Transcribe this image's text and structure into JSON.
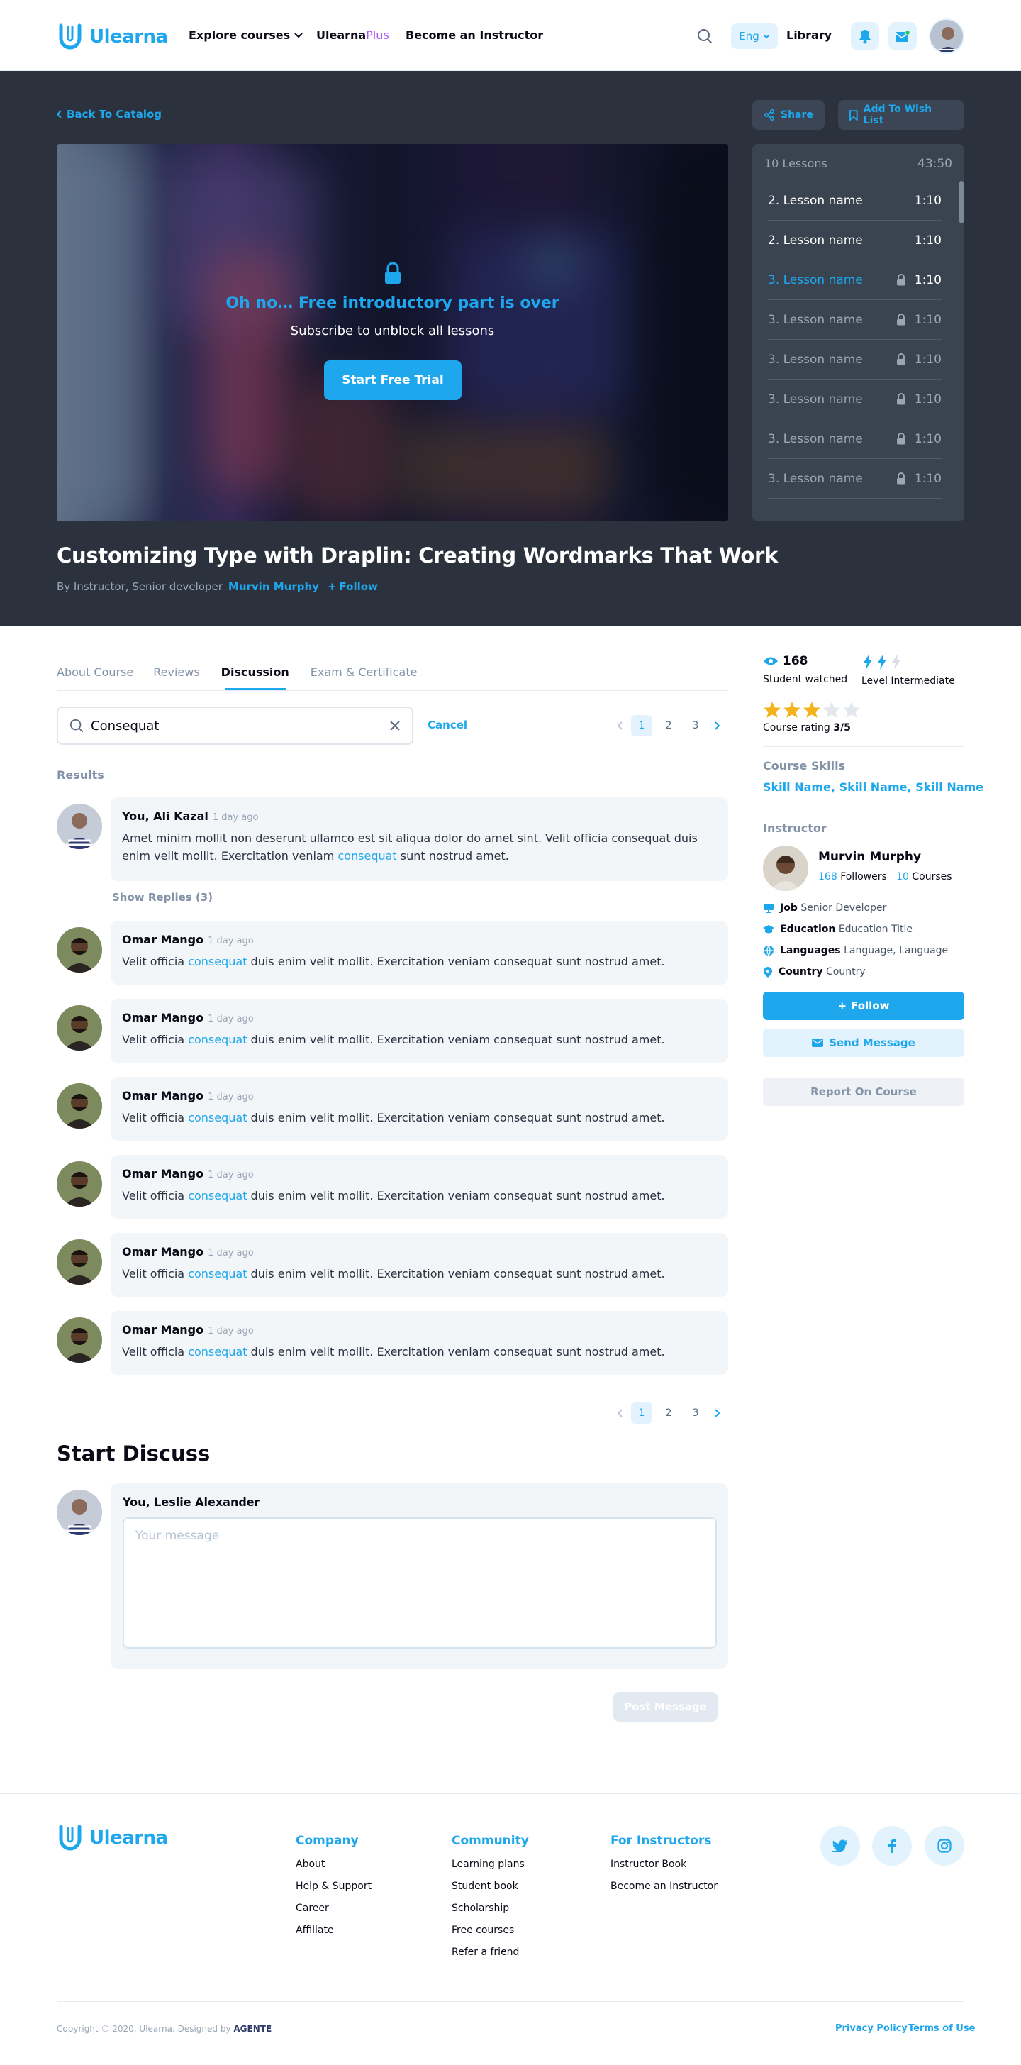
{
  "header": {
    "logo": "Ulearna",
    "nav": {
      "explore": "Explore courses",
      "plus_a": "Ulearna",
      "plus_b": "Plus",
      "instructor": "Become an Instructor"
    },
    "lang": "Eng",
    "library": "Library"
  },
  "hero": {
    "back": "Back To Catalog",
    "share": "Share",
    "wishlist": "Add To Wish List",
    "overlay_title": "Oh no… Free introductory part is over",
    "overlay_sub": "Subscribe to unblock all lessons",
    "trial_button": "Start Free Trial",
    "lessons_count": "10 Lessons",
    "lessons_total": "43:50",
    "lessons": [
      {
        "name": "2. Lesson name",
        "time": "1:10",
        "state": "open"
      },
      {
        "name": "2. Lesson name",
        "time": "1:10",
        "state": "open"
      },
      {
        "name": "3. Lesson name",
        "time": "1:10",
        "state": "active"
      },
      {
        "name": "3. Lesson name",
        "time": "1:10",
        "state": "locked"
      },
      {
        "name": "3. Lesson name",
        "time": "1:10",
        "state": "locked"
      },
      {
        "name": "3. Lesson name",
        "time": "1:10",
        "state": "locked"
      },
      {
        "name": "3. Lesson name",
        "time": "1:10",
        "state": "locked"
      },
      {
        "name": "3. Lesson name",
        "time": "1:10",
        "state": "locked"
      }
    ],
    "course_title": "Customizing Type with Draplin: Creating Wordmarks That Work",
    "by_line": "By Instructor, Senior developer",
    "author": "Murvin Murphy",
    "follow": "Follow"
  },
  "tabs": [
    "About Course",
    "Reviews",
    "Discussion",
    "Exam & Certificate"
  ],
  "search": {
    "value": "Consequat",
    "cancel": "Cancel"
  },
  "pagination": [
    "1",
    "2",
    "3"
  ],
  "results_label": "Results",
  "first_comment": {
    "author": "You, Ali Kazal",
    "time": "1 day ago",
    "text_a": "Amet minim mollit non deserunt ullamco est sit aliqua dolor do amet sint. Velit officia consequat duis enim velit mollit. Exercitation veniam ",
    "highlight": "consequat",
    "text_b": " sunt nostrud amet."
  },
  "show_replies": "Show Replies (3)",
  "replies": [
    {
      "author": "Omar Mango",
      "time": "1 day ago",
      "text_a": "Velit officia ",
      "highlight": "consequat",
      "text_b": " duis enim velit mollit. Exercitation veniam consequat sunt nostrud amet."
    },
    {
      "author": "Omar Mango",
      "time": "1 day ago",
      "text_a": "Velit officia ",
      "highlight": "consequat",
      "text_b": " duis enim velit mollit. Exercitation veniam consequat sunt nostrud amet."
    },
    {
      "author": "Omar Mango",
      "time": "1 day ago",
      "text_a": "Velit officia ",
      "highlight": "consequat",
      "text_b": " duis enim velit mollit. Exercitation veniam consequat sunt nostrud amet."
    },
    {
      "author": "Omar Mango",
      "time": "1 day ago",
      "text_a": "Velit officia ",
      "highlight": "consequat",
      "text_b": " duis enim velit mollit. Exercitation veniam consequat sunt nostrud amet."
    },
    {
      "author": "Omar Mango",
      "time": "1 day ago",
      "text_a": "Velit officia ",
      "highlight": "consequat",
      "text_b": " duis enim velit mollit. Exercitation veniam consequat sunt nostrud amet."
    },
    {
      "author": "Omar Mango",
      "time": "1 day ago",
      "text_a": "Velit officia ",
      "highlight": "consequat",
      "text_b": " duis enim velit mollit. Exercitation veniam consequat sunt nostrud amet."
    }
  ],
  "discuss": {
    "title": "Start Discuss",
    "author": "You, Leslie Alexander",
    "placeholder": "Your message",
    "post": "Post Message"
  },
  "sidebar": {
    "watched_count": "168",
    "watched_label": "Student watched",
    "level_label": "Level Intermediate",
    "level_value": 2,
    "level_max": 3,
    "rating_label": "Course rating",
    "rating_value": "3/5",
    "rating_stars": 3,
    "skills_label": "Course Skills",
    "skills": [
      "Skill Name",
      "Skill Name",
      "Skill Name"
    ],
    "instructor_label": "Instructor",
    "instructor_name": "Murvin Murphy",
    "followers_count": "168",
    "followers_label": "Followers",
    "courses_count": "10",
    "courses_label": "Courses",
    "job_key": "Job",
    "job_val": "Senior Developer",
    "edu_key": "Education",
    "edu_val": "Education Title",
    "lang_key": "Languages",
    "lang_val": "Language, Language",
    "country_key": "Country",
    "country_val": "Country",
    "follow": "Follow",
    "message": "Send Message",
    "report": "Report On Course"
  },
  "footer": {
    "logo": "Ulearna",
    "company": {
      "title": "Company",
      "links": [
        "About",
        "Help & Support",
        "Career",
        "Affiliate"
      ]
    },
    "community": {
      "title": "Community",
      "links": [
        "Learning plans",
        "Student book",
        "Scholarship",
        "Free courses",
        "Refer a friend"
      ]
    },
    "instructors": {
      "title": "For Instructors",
      "links": [
        "Instructor Book",
        "Become an Instructor"
      ]
    },
    "copyright": "Copyright © 2020, Ulearna. Designed by",
    "designer": "AGENTE",
    "privacy": "Privacy Policy",
    "terms": "Terms of Use"
  },
  "colors": {
    "accent": "#1ea7ec",
    "plus": "#a855f7",
    "hero_bg": "#2b323d",
    "star": "#f5b31b"
  }
}
